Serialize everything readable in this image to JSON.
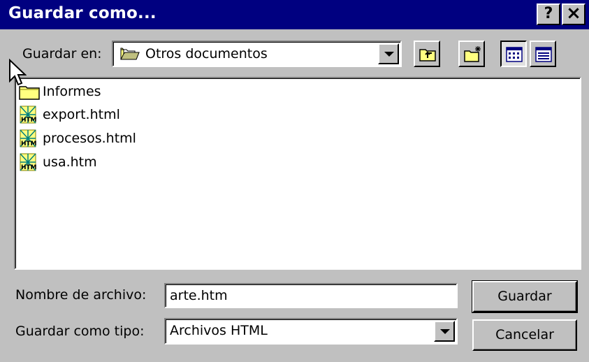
{
  "window": {
    "title": "Guardar como...",
    "help_label": "?",
    "close_label": "×"
  },
  "lookin": {
    "label": "Guardar en:",
    "value": "Otros documentos",
    "folder_icon": "open-folder-icon"
  },
  "toolbar": {
    "items": [
      {
        "name": "up-one-level-button",
        "icon": "folder-up-icon"
      },
      {
        "name": "create-new-folder-button",
        "icon": "new-folder-icon"
      },
      {
        "name": "list-view-button",
        "icon": "list-view-icon",
        "pressed": true
      },
      {
        "name": "details-view-button",
        "icon": "details-view-icon",
        "pressed": false
      }
    ]
  },
  "files": [
    {
      "name": "Informes",
      "icon": "folder-icon"
    },
    {
      "name": "export.html",
      "icon": "html-file-icon"
    },
    {
      "name": "procesos.html",
      "icon": "html-file-icon"
    },
    {
      "name": "usa.htm",
      "icon": "html-file-icon"
    }
  ],
  "filename": {
    "label": "Nombre de archivo:",
    "value": "arte.htm"
  },
  "filetype": {
    "label": "Guardar como tipo:",
    "value": "Archivos HTML"
  },
  "buttons": {
    "save": "Guardar",
    "cancel": "Cancelar"
  },
  "colors": {
    "titlebar": "#000080",
    "face": "#c0c0c0",
    "folder": "#ffff80"
  }
}
